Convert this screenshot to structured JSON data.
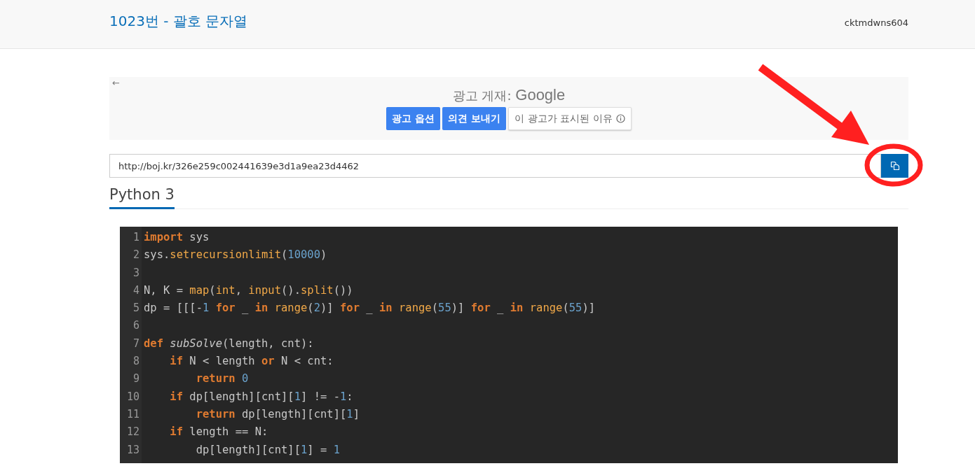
{
  "header": {
    "title": "1023번 - 괄호 문자열",
    "user": "cktmdwns604"
  },
  "ad": {
    "back": "←",
    "label": "광고 게재:",
    "brand": "Google",
    "buttons": [
      {
        "label": "광고 옵션",
        "kind": "primary"
      },
      {
        "label": "의견 보내기",
        "kind": "primary"
      },
      {
        "label": "이 광고가 표시된 이유",
        "kind": "info"
      }
    ]
  },
  "share": {
    "value": "http://boj.kr/326e259c002441639e3d1a9ea23d4462"
  },
  "language": "Python 3",
  "code": [
    {
      "number": "1",
      "tokens": [
        {
          "kind": "kw",
          "text": "import"
        },
        {
          "kind": "plain",
          "text": " sys"
        }
      ]
    },
    {
      "number": "2",
      "tokens": [
        {
          "kind": "plain",
          "text": "sys."
        },
        {
          "kind": "fn",
          "text": "setrecursionlimit"
        },
        {
          "kind": "plain",
          "text": "("
        },
        {
          "kind": "num",
          "text": "10000"
        },
        {
          "kind": "plain",
          "text": ")"
        }
      ]
    },
    {
      "number": "3"
    },
    {
      "number": "4",
      "tokens": [
        {
          "kind": "plain",
          "text": "N, K = "
        },
        {
          "kind": "fn",
          "text": "map"
        },
        {
          "kind": "plain",
          "text": "("
        },
        {
          "kind": "fn",
          "text": "int"
        },
        {
          "kind": "plain",
          "text": ", "
        },
        {
          "kind": "fn",
          "text": "input"
        },
        {
          "kind": "plain",
          "text": "()."
        },
        {
          "kind": "fn",
          "text": "split"
        },
        {
          "kind": "plain",
          "text": "())"
        }
      ]
    },
    {
      "number": "5",
      "tokens": [
        {
          "kind": "plain",
          "text": "dp = [[[-"
        },
        {
          "kind": "num",
          "text": "1"
        },
        {
          "kind": "kw",
          "text": " for"
        },
        {
          "kind": "plain",
          "text": " _ "
        },
        {
          "kind": "kw",
          "text": "in"
        },
        {
          "kind": "fn",
          "text": " range"
        },
        {
          "kind": "plain",
          "text": "("
        },
        {
          "kind": "num",
          "text": "2"
        },
        {
          "kind": "plain",
          "text": ")] "
        },
        {
          "kind": "kw",
          "text": "for"
        },
        {
          "kind": "plain",
          "text": " _ "
        },
        {
          "kind": "kw",
          "text": "in"
        },
        {
          "kind": "fn",
          "text": " range"
        },
        {
          "kind": "plain",
          "text": "("
        },
        {
          "kind": "num",
          "text": "55"
        },
        {
          "kind": "plain",
          "text": ")] "
        },
        {
          "kind": "kw",
          "text": "for"
        },
        {
          "kind": "plain",
          "text": " _ "
        },
        {
          "kind": "kw",
          "text": "in"
        },
        {
          "kind": "fn",
          "text": " range"
        },
        {
          "kind": "plain",
          "text": "("
        },
        {
          "kind": "num",
          "text": "55"
        },
        {
          "kind": "plain",
          "text": ")]"
        }
      ]
    },
    {
      "number": "6"
    },
    {
      "number": "7",
      "tokens": [
        {
          "kind": "kw",
          "text": "def"
        },
        {
          "kind": "name",
          "text": " subSolve"
        },
        {
          "kind": "plain",
          "text": "(length, cnt):"
        }
      ]
    },
    {
      "number": "8",
      "tokens": [
        {
          "kind": "kw",
          "text": "    if"
        },
        {
          "kind": "plain",
          "text": " N < length "
        },
        {
          "kind": "kw",
          "text": "or"
        },
        {
          "kind": "plain",
          "text": " N < cnt:"
        }
      ]
    },
    {
      "number": "9",
      "tokens": [
        {
          "kind": "kw",
          "text": "        return"
        },
        {
          "kind": "num",
          "text": " 0"
        }
      ]
    },
    {
      "number": "10",
      "tokens": [
        {
          "kind": "kw",
          "text": "    if"
        },
        {
          "kind": "plain",
          "text": " dp[length][cnt]["
        },
        {
          "kind": "num",
          "text": "1"
        },
        {
          "kind": "plain",
          "text": "] != -"
        },
        {
          "kind": "num",
          "text": "1"
        },
        {
          "kind": "plain",
          "text": ":"
        }
      ]
    },
    {
      "number": "11",
      "tokens": [
        {
          "kind": "kw",
          "text": "        return"
        },
        {
          "kind": "plain",
          "text": " dp[length][cnt]["
        },
        {
          "kind": "num",
          "text": "1"
        },
        {
          "kind": "plain",
          "text": "]"
        }
      ]
    },
    {
      "number": "12",
      "tokens": [
        {
          "kind": "kw",
          "text": "    if"
        },
        {
          "kind": "plain",
          "text": " length == N:"
        }
      ]
    },
    {
      "number": "13",
      "tokens": [
        {
          "kind": "plain",
          "text": "        dp[length][cnt]["
        },
        {
          "kind": "num",
          "text": "1"
        },
        {
          "kind": "plain",
          "text": "] = "
        },
        {
          "kind": "num",
          "text": "1"
        }
      ]
    }
  ]
}
